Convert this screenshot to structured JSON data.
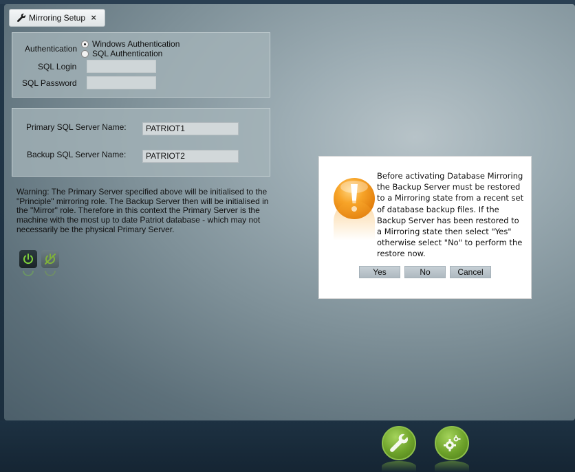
{
  "tab": {
    "label": "Mirroring Setup",
    "close": "×"
  },
  "auth": {
    "label": "Authentication",
    "options": [
      "Windows Authentication",
      "SQL Authentication"
    ],
    "selected": "Windows Authentication",
    "sql_login_label": "SQL Login",
    "sql_login_value": "",
    "sql_password_label": "SQL Password",
    "sql_password_value": ""
  },
  "servers": {
    "primary_label": "Primary SQL Server Name:",
    "primary_value": "PATRIOT1",
    "backup_label": "Backup SQL Server Name:",
    "backup_value": "PATRIOT2"
  },
  "warning_text": "Warning: The Primary Server specified above will be initialised to the \"Principle\" mirroring role. The Backup Server then will be initialised in the \"Mirror\" role. Therefore in this context the Primary Server is the machine with the most up to date Patriot database - which may not necessarily be the physical Primary Server.",
  "dialog": {
    "message": "Before activating Database Mirroring the Backup Server must be restored to a Mirroring state from a recent set of database backup files. If the Backup Server has been restored to a Mirroring state then select \"Yes\" otherwise select \"No\" to perform the restore now.",
    "yes": "Yes",
    "no": "No",
    "cancel": "Cancel"
  },
  "icons": {
    "tab": "wrench-icon",
    "power": "power-icon",
    "power_off": "power-off-icon",
    "warning": "exclamation-icon",
    "bottom": [
      "wrench-icon",
      "gear-icon"
    ]
  },
  "colors": {
    "accent_green": "#6da22a",
    "dialog_icon_orange": "#f39a1e",
    "button_face": "#aeb9c0"
  }
}
